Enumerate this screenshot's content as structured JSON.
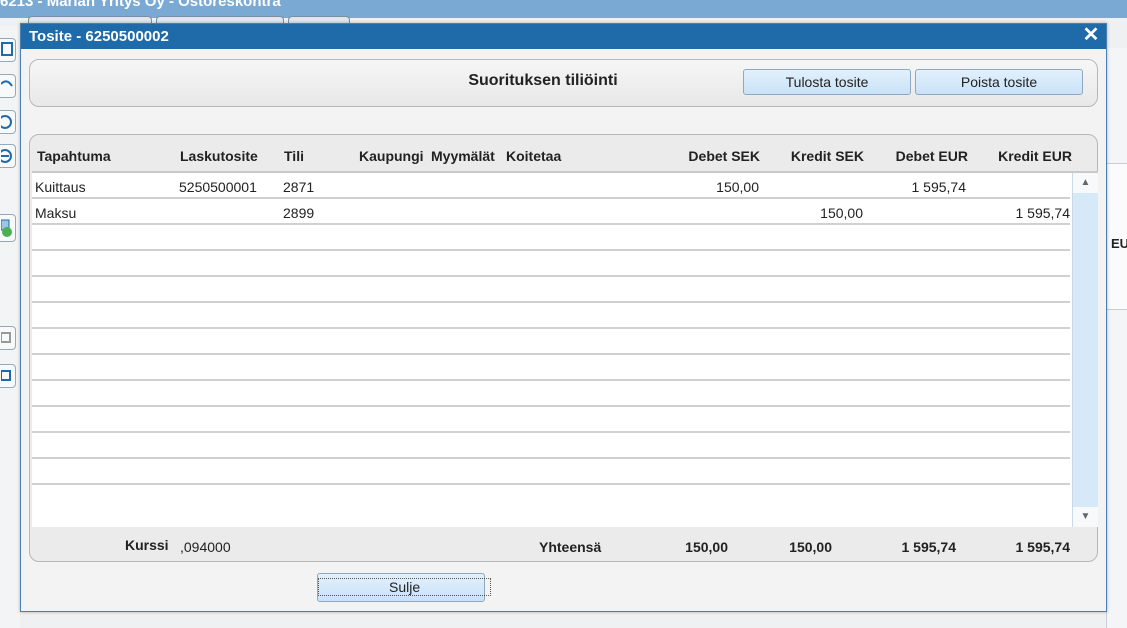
{
  "app": {
    "title": "6213 - Marian Yritys Oy - Ostoreskontra",
    "right_partial_text": "EU"
  },
  "dialog": {
    "title": "Tosite - 6250500002",
    "heading": "Suorituksen tiliöinti",
    "print_button": "Tulosta tosite",
    "delete_button": "Poista tosite",
    "close_button": "Sulje"
  },
  "table": {
    "columns": [
      "Tapahtuma",
      "Laskutosite",
      "Tili",
      "Kaupungi",
      "Myymälät",
      "Koitetaa",
      "Debet SEK",
      "Kredit SEK",
      "Debet EUR",
      "Kredit EUR"
    ],
    "rows": [
      {
        "tapahtuma": "Kuittaus",
        "laskutosite": "5250500001",
        "tili": "2871",
        "debet_sek": "150,00",
        "kredit_sek": "",
        "debet_eur": "1 595,74",
        "kredit_eur": ""
      },
      {
        "tapahtuma": "Maksu",
        "laskutosite": "",
        "tili": "2899",
        "debet_sek": "",
        "kredit_sek": "150,00",
        "debet_eur": "",
        "kredit_eur": "1 595,74"
      }
    ]
  },
  "footer": {
    "kurssi_label": "Kurssi",
    "kurssi_value": ",094000",
    "total_label": "Yhteensä",
    "debet_sek": "150,00",
    "kredit_sek": "150,00",
    "debet_eur": "1 595,74",
    "kredit_eur": "1 595,74"
  }
}
